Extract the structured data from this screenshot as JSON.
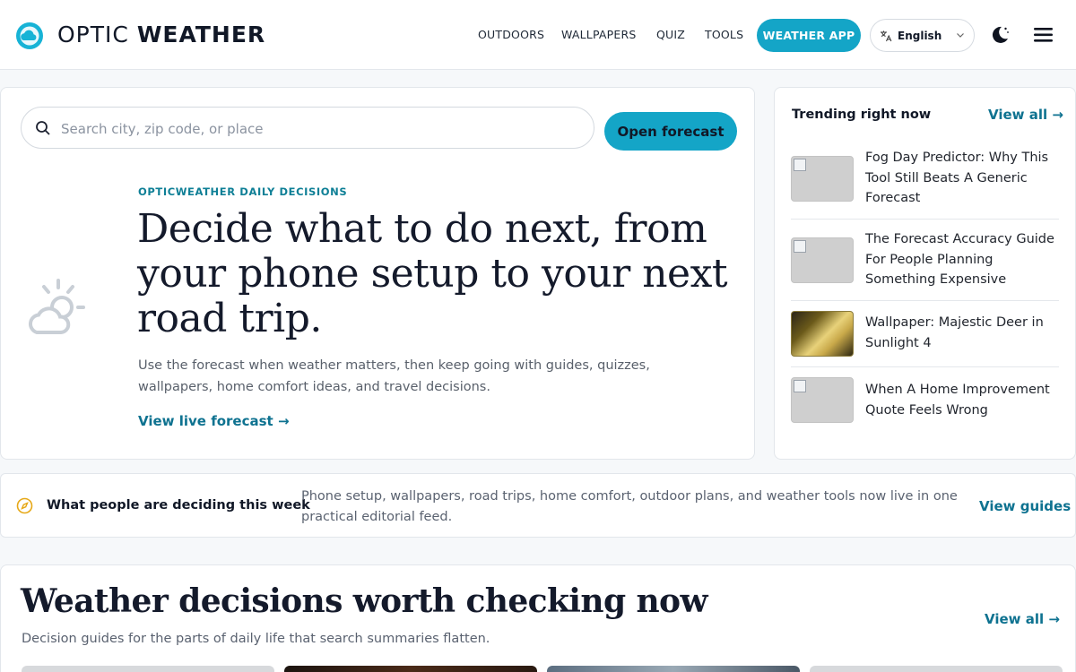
{
  "header": {
    "brand_light": "OPTIC ",
    "brand_bold": "WEATHER",
    "nav": [
      "OUTDOORS",
      "WALLPAPERS",
      "QUIZ",
      "TOOLS"
    ],
    "weather_app": "WEATHER APP",
    "language": "English",
    "icons": [
      "logo-cloud-icon",
      "translate-icon",
      "chevron-down-icon",
      "moon-icon",
      "menu-icon"
    ]
  },
  "hero": {
    "search_placeholder": "Search city, zip code, or place",
    "open_forecast": "Open forecast",
    "kicker": "OPTICWEATHER DAILY DECISIONS",
    "headline": "Decide what to do next, from your phone setup to your next road trip.",
    "subtext": "Use the forecast when weather matters, then keep going with guides, quizzes, wallpapers, home comfort ideas, and travel decisions.",
    "live_link": "View live forecast"
  },
  "trending": {
    "title": "Trending right now",
    "view_all": "View all",
    "items": [
      {
        "title": "Fog Day Predictor: Why This Tool Still Beats A Generic Forecast",
        "thumb": "broken-image"
      },
      {
        "title": "The Forecast Accuracy Guide For People Planning Something Expensive",
        "thumb": "broken-image"
      },
      {
        "title": "Wallpaper: Majestic Deer in Sunlight 4",
        "thumb": "deer-image"
      },
      {
        "title": "When A Home Improvement Quote Feels Wrong",
        "thumb": "broken-image"
      }
    ]
  },
  "strip": {
    "label": "What people are deciding this week",
    "description": "Phone setup, wallpapers, road trips, home comfort, outdoor plans, and weather tools now live in one practical editorial feed.",
    "link": "View guides"
  },
  "section": {
    "title": "Weather decisions worth checking now",
    "subtitle": "Decision guides for the parts of daily life that search summaries flatten.",
    "view_all": "View all"
  },
  "colors": {
    "accent": "#14a5c7",
    "link": "#0e7290",
    "kicker": "#0e7f96"
  }
}
